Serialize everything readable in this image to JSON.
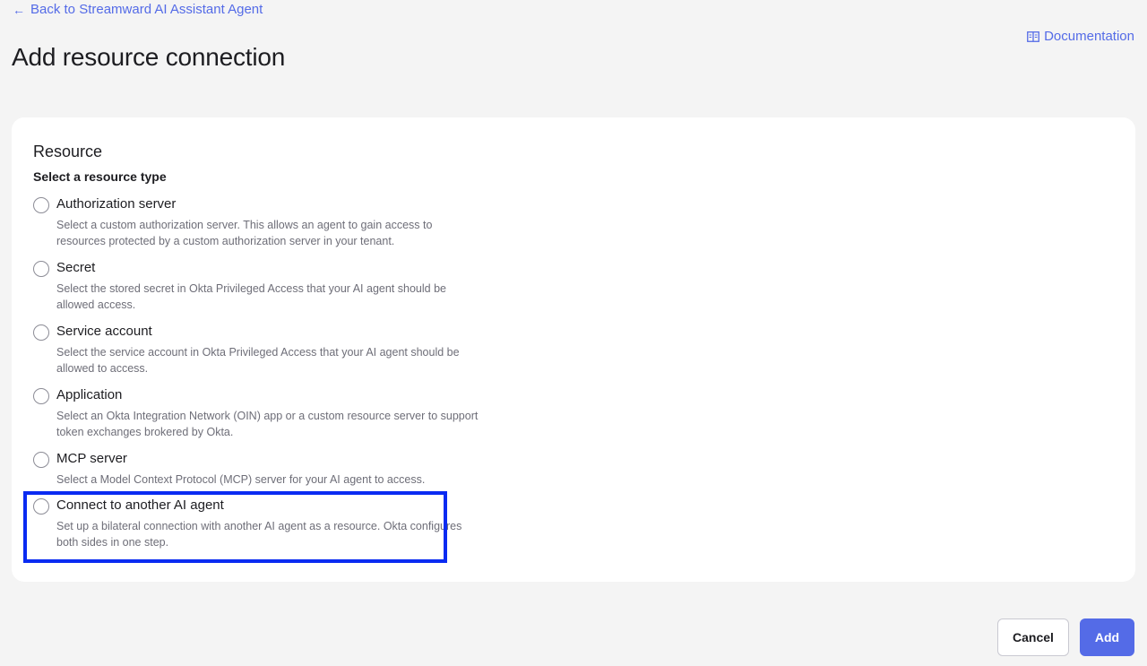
{
  "nav": {
    "back_arrow": "←",
    "back_label": "Back to Streamward AI Assistant Agent",
    "doc_icon": "book-icon",
    "doc_label": "Documentation"
  },
  "page": {
    "title": "Add resource connection"
  },
  "resource": {
    "section_title": "Resource",
    "legend": "Select a resource type",
    "options": [
      {
        "label": "Authorization server",
        "description": "Select a custom authorization server. This allows an agent to gain access to resources protected by a custom authorization server in your tenant."
      },
      {
        "label": "Secret",
        "description": "Select the stored secret in Okta Privileged Access that your AI agent should be allowed access."
      },
      {
        "label": "Service account",
        "description": "Select the service account in Okta Privileged Access that your AI agent should be allowed to access."
      },
      {
        "label": "Application",
        "description": "Select an Okta Integration Network (OIN) app or a custom resource server to support token exchanges brokered by Okta."
      },
      {
        "label": "MCP server",
        "description": "Select a Model Context Protocol (MCP) server for your AI agent to access."
      },
      {
        "label": "Connect to another AI agent",
        "description": "Set up a bilateral connection with another AI agent as a resource. Okta configures both sides in one step."
      }
    ]
  },
  "actions": {
    "cancel_label": "Cancel",
    "add_label": "Add"
  },
  "colors": {
    "accent": "#546be7",
    "highlight": "#0a2bf2",
    "background": "#f4f4f4"
  }
}
